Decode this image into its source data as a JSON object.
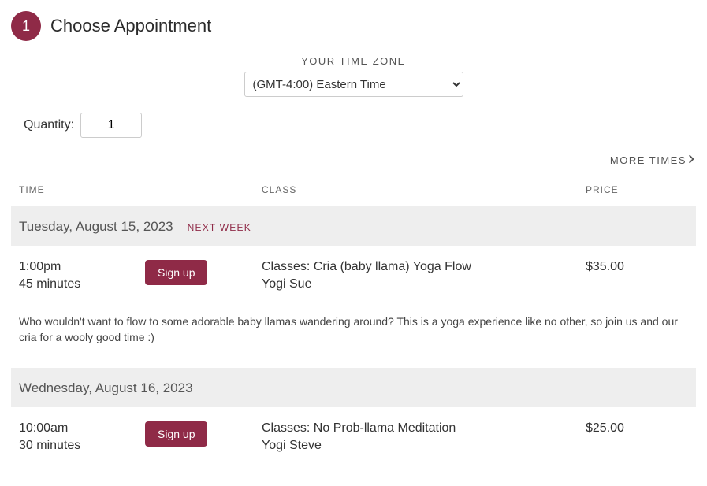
{
  "step": {
    "number": "1",
    "title": "Choose Appointment"
  },
  "timezone": {
    "label": "YOUR TIME ZONE",
    "value": "(GMT-4:00) Eastern Time"
  },
  "quantity": {
    "label": "Quantity:",
    "value": "1"
  },
  "more_times": "MORE TIMES ",
  "headers": {
    "time": "TIME",
    "class": "CLASS",
    "price": "PRICE"
  },
  "groups": [
    {
      "date": "Tuesday, August 15, 2023",
      "badge": "NEXT WEEK",
      "items": [
        {
          "time": "1:00pm",
          "duration": "45 minutes",
          "signup": "Sign up",
          "class_name": "Classes: Cria (baby llama) Yoga Flow",
          "instructor": "Yogi Sue",
          "price": "$35.00",
          "description": "Who wouldn't want to flow to some adorable baby llamas wandering around? This is a yoga experience like no other, so join us and our cria for a wooly good time :)"
        }
      ]
    },
    {
      "date": "Wednesday, August 16, 2023",
      "badge": "",
      "items": [
        {
          "time": "10:00am",
          "duration": "30 minutes",
          "signup": "Sign up",
          "class_name": "Classes: No Prob-llama Meditation",
          "instructor": "Yogi Steve",
          "price": "$25.00",
          "description": ""
        }
      ]
    }
  ]
}
